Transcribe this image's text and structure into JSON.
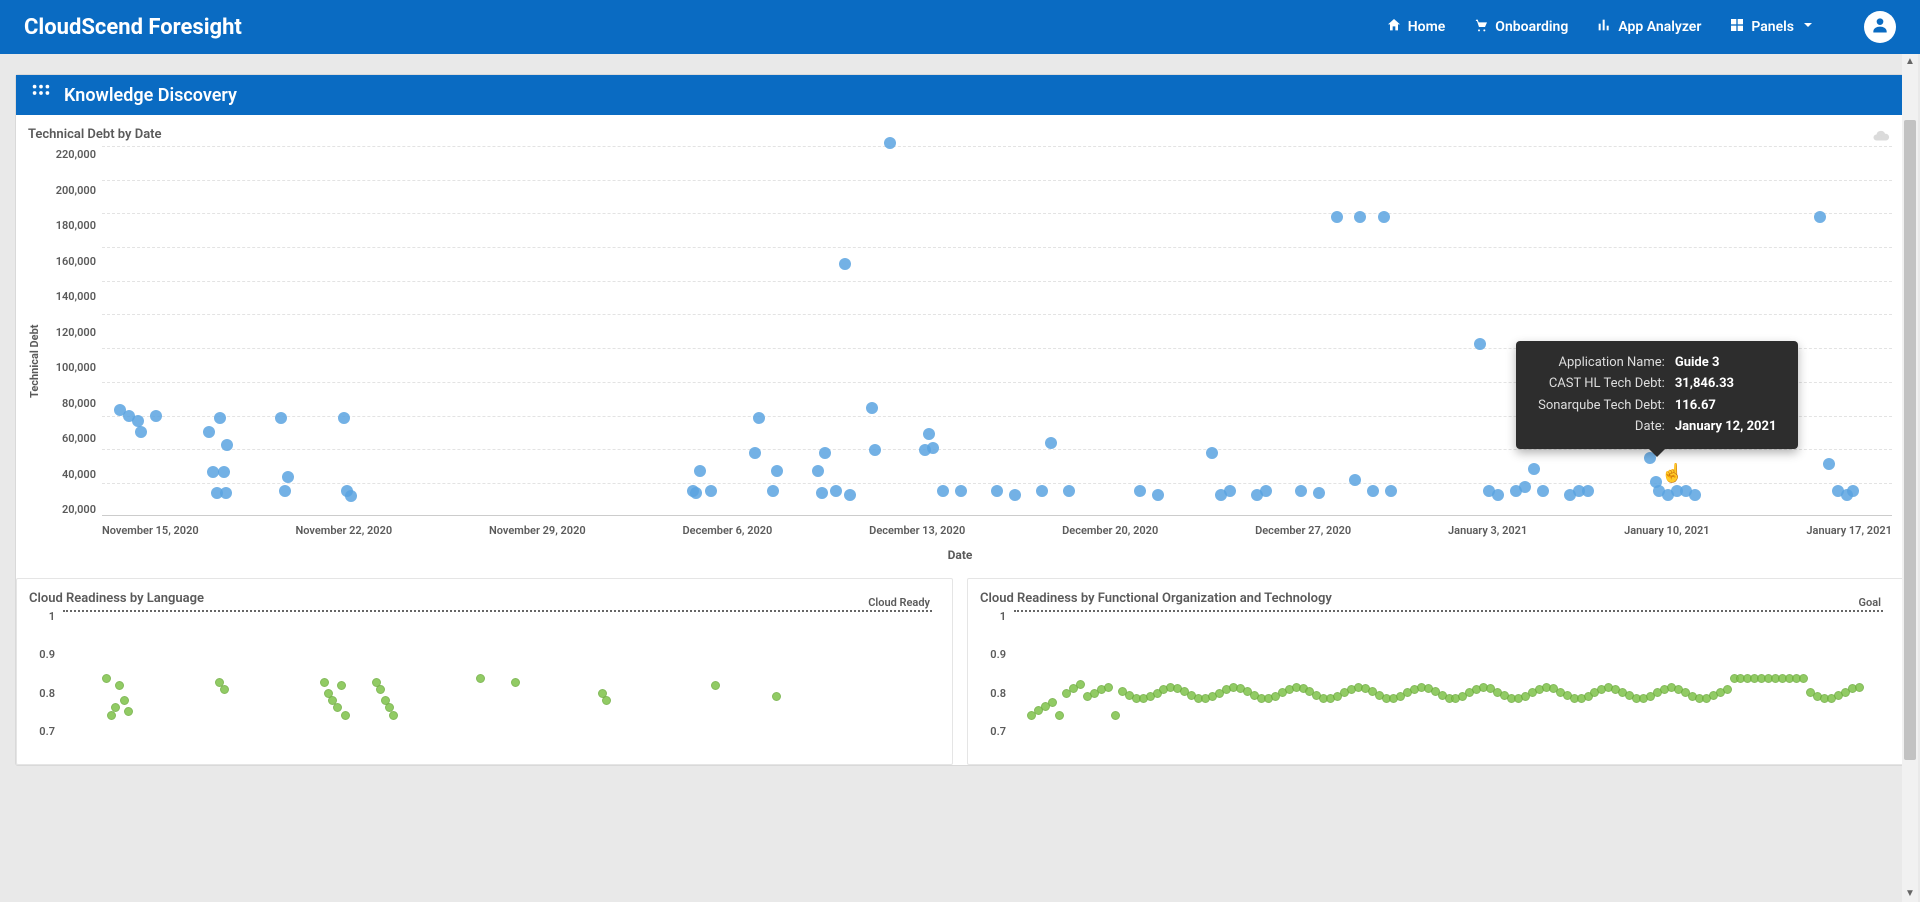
{
  "header": {
    "brand": "CloudScend Foresight",
    "nav": {
      "home": "Home",
      "onboarding": "Onboarding",
      "app_analyzer": "App Analyzer",
      "panels": "Panels"
    }
  },
  "panel": {
    "title": "Knowledge Discovery"
  },
  "chart1": {
    "title": "Technical Debt by Date",
    "ylabel": "Technical Debt",
    "xlabel": "Date",
    "y_ticks": [
      "220,000",
      "200,000",
      "180,000",
      "160,000",
      "140,000",
      "120,000",
      "100,000",
      "80,000",
      "60,000",
      "40,000",
      "20,000"
    ],
    "x_ticks": [
      "November 15, 2020",
      "November 22, 2020",
      "November 29, 2020",
      "December 6, 2020",
      "December 13, 2020",
      "December 20, 2020",
      "December 27, 2020",
      "January 3, 2021",
      "January 10, 2021",
      "January 17, 2021"
    ]
  },
  "tooltip": {
    "labels": {
      "app": "Application Name:",
      "cast": "CAST HL Tech Debt:",
      "sonar": "Sonarqube Tech Debt:",
      "date": "Date:"
    },
    "values": {
      "app": "Guide 3",
      "cast": "31,846.33",
      "sonar": "116.67",
      "date": "January 12, 2021"
    }
  },
  "chart2": {
    "title": "Cloud Readiness by Language",
    "goal_label": "Cloud Ready",
    "y_ticks": [
      "1",
      "0.9",
      "0.8",
      "0.7"
    ]
  },
  "chart3": {
    "title": "Cloud Readiness by Functional Organization and Technology",
    "goal_label": "Goal",
    "y_ticks": [
      "1",
      "0.9",
      "0.8",
      "0.7"
    ]
  },
  "chart_data": [
    {
      "type": "scatter",
      "title": "Technical Debt by Date",
      "xlabel": "Date",
      "ylabel": "Technical Debt",
      "ylim": [
        0,
        230000
      ],
      "x_tick_labels": [
        "November 15, 2020",
        "November 22, 2020",
        "November 29, 2020",
        "December 6, 2020",
        "December 13, 2020",
        "December 20, 2020",
        "December 27, 2020",
        "January 3, 2021",
        "January 10, 2021",
        "January 17, 2021"
      ],
      "tooltip_point": {
        "app": "Guide 3",
        "cast_hl_tech_debt": 31846.33,
        "sonarqube_tech_debt": 116.67,
        "date": "January 12, 2021"
      },
      "points": [
        {
          "x_pct": 1.0,
          "y": 62000
        },
        {
          "x_pct": 1.5,
          "y": 58000
        },
        {
          "x_pct": 2.0,
          "y": 55000
        },
        {
          "x_pct": 2.2,
          "y": 48000
        },
        {
          "x_pct": 3.0,
          "y": 58000
        },
        {
          "x_pct": 6.0,
          "y": 48000
        },
        {
          "x_pct": 6.2,
          "y": 23000
        },
        {
          "x_pct": 6.4,
          "y": 10000
        },
        {
          "x_pct": 6.6,
          "y": 57000
        },
        {
          "x_pct": 6.8,
          "y": 23000
        },
        {
          "x_pct": 7.0,
          "y": 40000
        },
        {
          "x_pct": 6.9,
          "y": 10000
        },
        {
          "x_pct": 10.0,
          "y": 57000
        },
        {
          "x_pct": 10.2,
          "y": 11000
        },
        {
          "x_pct": 10.4,
          "y": 20000
        },
        {
          "x_pct": 13.5,
          "y": 57000
        },
        {
          "x_pct": 13.7,
          "y": 11000
        },
        {
          "x_pct": 13.9,
          "y": 8000
        },
        {
          "x_pct": 33.0,
          "y": 11000
        },
        {
          "x_pct": 33.2,
          "y": 10000
        },
        {
          "x_pct": 33.4,
          "y": 24000
        },
        {
          "x_pct": 34.0,
          "y": 11000
        },
        {
          "x_pct": 36.5,
          "y": 35000
        },
        {
          "x_pct": 36.7,
          "y": 57000
        },
        {
          "x_pct": 37.5,
          "y": 11000
        },
        {
          "x_pct": 37.7,
          "y": 24000
        },
        {
          "x_pct": 40.0,
          "y": 24000
        },
        {
          "x_pct": 40.2,
          "y": 10000
        },
        {
          "x_pct": 40.4,
          "y": 35000
        },
        {
          "x_pct": 41.5,
          "y": 153000
        },
        {
          "x_pct": 41.0,
          "y": 11000
        },
        {
          "x_pct": 41.8,
          "y": 9000
        },
        {
          "x_pct": 43.0,
          "y": 63000
        },
        {
          "x_pct": 43.2,
          "y": 37000
        },
        {
          "x_pct": 44.0,
          "y": 228000
        },
        {
          "x_pct": 46.0,
          "y": 37000
        },
        {
          "x_pct": 46.2,
          "y": 47000
        },
        {
          "x_pct": 46.4,
          "y": 38000
        },
        {
          "x_pct": 47.0,
          "y": 11000
        },
        {
          "x_pct": 48.0,
          "y": 11000
        },
        {
          "x_pct": 50.0,
          "y": 11000
        },
        {
          "x_pct": 51.0,
          "y": 9000
        },
        {
          "x_pct": 52.5,
          "y": 11000
        },
        {
          "x_pct": 53.0,
          "y": 41000
        },
        {
          "x_pct": 54.0,
          "y": 11000
        },
        {
          "x_pct": 58.0,
          "y": 11000
        },
        {
          "x_pct": 59.0,
          "y": 9000
        },
        {
          "x_pct": 62.0,
          "y": 35000
        },
        {
          "x_pct": 62.5,
          "y": 9000
        },
        {
          "x_pct": 63.0,
          "y": 11000
        },
        {
          "x_pct": 64.5,
          "y": 9000
        },
        {
          "x_pct": 65.0,
          "y": 11000
        },
        {
          "x_pct": 67.0,
          "y": 11000
        },
        {
          "x_pct": 68.0,
          "y": 10000
        },
        {
          "x_pct": 69.0,
          "y": 182000
        },
        {
          "x_pct": 70.3,
          "y": 182000
        },
        {
          "x_pct": 71.6,
          "y": 182000
        },
        {
          "x_pct": 70.0,
          "y": 18000
        },
        {
          "x_pct": 71.0,
          "y": 11000
        },
        {
          "x_pct": 72.0,
          "y": 11000
        },
        {
          "x_pct": 77.0,
          "y": 103000
        },
        {
          "x_pct": 77.5,
          "y": 11000
        },
        {
          "x_pct": 78.0,
          "y": 9000
        },
        {
          "x_pct": 79.0,
          "y": 11000
        },
        {
          "x_pct": 79.5,
          "y": 14000
        },
        {
          "x_pct": 80.0,
          "y": 25000
        },
        {
          "x_pct": 80.5,
          "y": 11000
        },
        {
          "x_pct": 82.0,
          "y": 9000
        },
        {
          "x_pct": 82.5,
          "y": 11000
        },
        {
          "x_pct": 83.0,
          "y": 11000
        },
        {
          "x_pct": 86.5,
          "y": 32000
        },
        {
          "x_pct": 86.8,
          "y": 17000
        },
        {
          "x_pct": 87.0,
          "y": 11000
        },
        {
          "x_pct": 87.5,
          "y": 9000
        },
        {
          "x_pct": 88.0,
          "y": 11000
        },
        {
          "x_pct": 88.5,
          "y": 11000
        },
        {
          "x_pct": 89.0,
          "y": 9000
        },
        {
          "x_pct": 96.0,
          "y": 182000
        },
        {
          "x_pct": 96.5,
          "y": 28000
        },
        {
          "x_pct": 97.0,
          "y": 11000
        },
        {
          "x_pct": 97.5,
          "y": 9000
        },
        {
          "x_pct": 97.8,
          "y": 11000
        }
      ]
    },
    {
      "type": "scatter",
      "title": "Cloud Readiness by Language",
      "ylabel": "",
      "ylim": [
        0.65,
        1.0
      ],
      "goal": 1.0,
      "goal_label": "Cloud Ready",
      "points": [
        {
          "x_pct": 5,
          "y": 0.8
        },
        {
          "x_pct": 5.5,
          "y": 0.7
        },
        {
          "x_pct": 6,
          "y": 0.72
        },
        {
          "x_pct": 6.5,
          "y": 0.78
        },
        {
          "x_pct": 7,
          "y": 0.74
        },
        {
          "x_pct": 7.5,
          "y": 0.71
        },
        {
          "x_pct": 18,
          "y": 0.79
        },
        {
          "x_pct": 18.5,
          "y": 0.77
        },
        {
          "x_pct": 30,
          "y": 0.79
        },
        {
          "x_pct": 30.5,
          "y": 0.76
        },
        {
          "x_pct": 31,
          "y": 0.74
        },
        {
          "x_pct": 31.5,
          "y": 0.72
        },
        {
          "x_pct": 32,
          "y": 0.78
        },
        {
          "x_pct": 32.5,
          "y": 0.7
        },
        {
          "x_pct": 36,
          "y": 0.79
        },
        {
          "x_pct": 36.5,
          "y": 0.77
        },
        {
          "x_pct": 37,
          "y": 0.74
        },
        {
          "x_pct": 37.5,
          "y": 0.72
        },
        {
          "x_pct": 38,
          "y": 0.7
        },
        {
          "x_pct": 48,
          "y": 0.8
        },
        {
          "x_pct": 52,
          "y": 0.79
        },
        {
          "x_pct": 62,
          "y": 0.76
        },
        {
          "x_pct": 62.5,
          "y": 0.74
        },
        {
          "x_pct": 75,
          "y": 0.78
        },
        {
          "x_pct": 82,
          "y": 0.75
        }
      ]
    },
    {
      "type": "scatter",
      "title": "Cloud Readiness by Functional Organization and Technology",
      "ylabel": "",
      "ylim": [
        0.65,
        1.0
      ],
      "goal": 1.0,
      "goal_label": "Goal",
      "points_note": "dense band of points mostly at y≈0.75–0.80 across full x range, a few dips to ~0.70",
      "sample_points": [
        {
          "x_pct": 2,
          "y": 0.7
        },
        {
          "x_pct": 3,
          "y": 0.81
        },
        {
          "x_pct": 4,
          "y": 0.78
        },
        {
          "x_pct": 5,
          "y": 0.72
        },
        {
          "x_pct": 6,
          "y": 0.79
        },
        {
          "x_pct": 7,
          "y": 0.76
        },
        {
          "x_pct": 8,
          "y": 0.8
        },
        {
          "x_pct": 9,
          "y": 0.74
        },
        {
          "x_pct": 10,
          "y": 0.78
        }
      ]
    }
  ]
}
